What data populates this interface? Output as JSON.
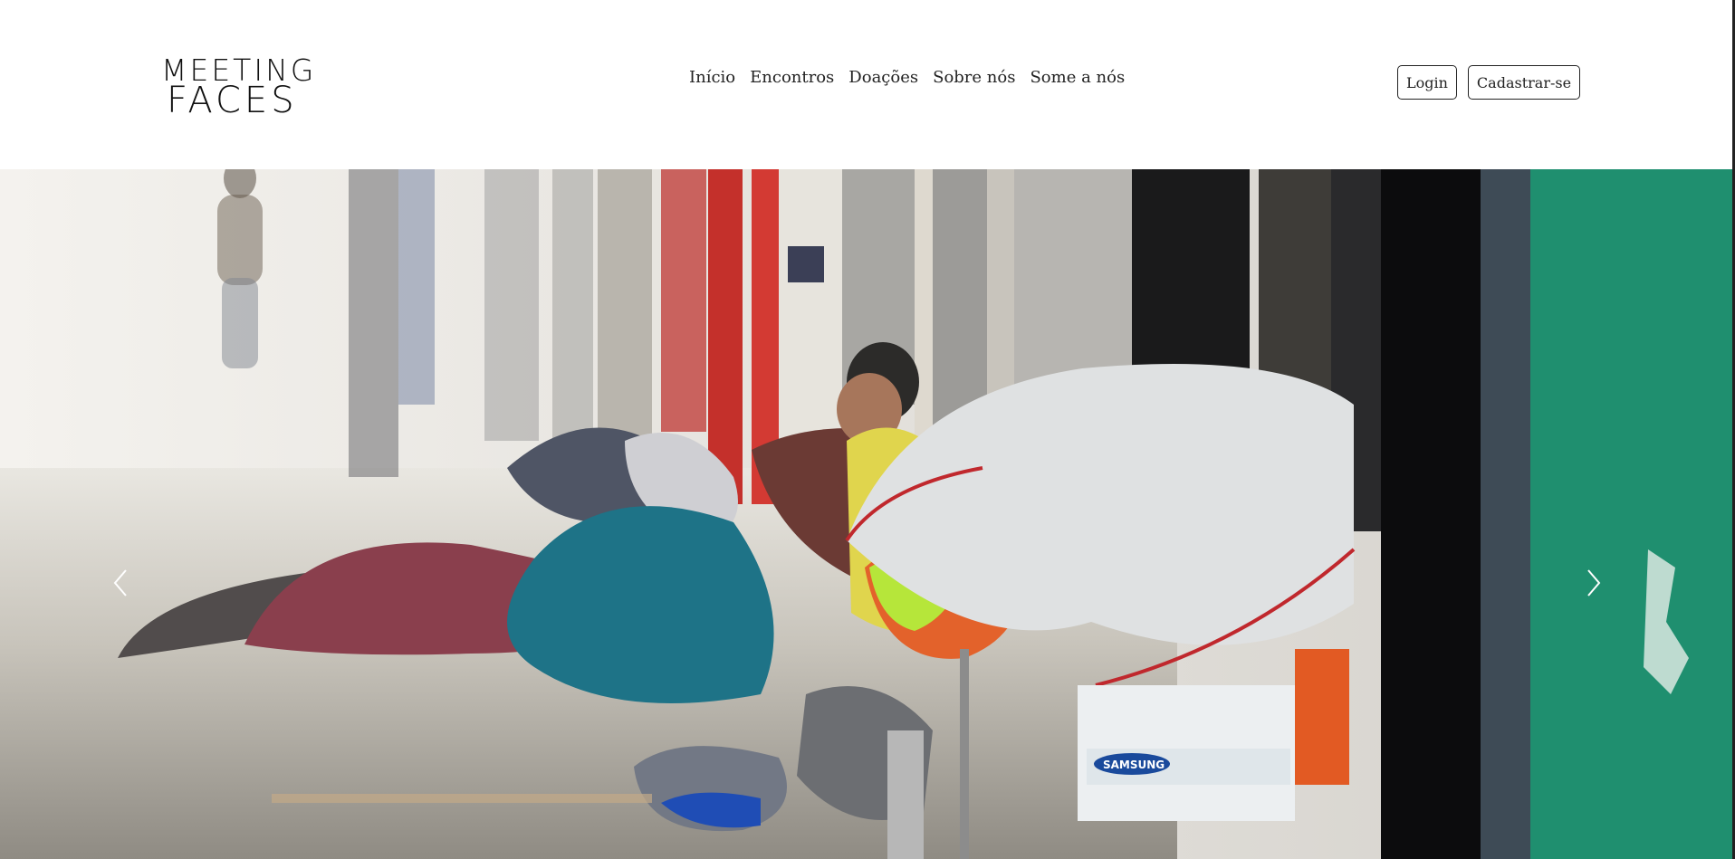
{
  "header": {
    "logo": {
      "line1": "MEETING",
      "line2": "FACES"
    },
    "nav": [
      {
        "label": "Início"
      },
      {
        "label": "Encontros"
      },
      {
        "label": "Doações"
      },
      {
        "label": "Sobre nós"
      },
      {
        "label": "Some a nós"
      }
    ],
    "auth": {
      "login_label": "Login",
      "signup_label": "Cadastrar-se"
    }
  },
  "hero": {
    "image_description": "street scene photo",
    "bag_brand_text": "SAMSUNG"
  },
  "colors": {
    "header_bg": "#ffffff",
    "text": "#222222",
    "button_border": "#222222"
  },
  "icons": {
    "prev": "chevron-left-icon",
    "next": "chevron-right-icon"
  }
}
